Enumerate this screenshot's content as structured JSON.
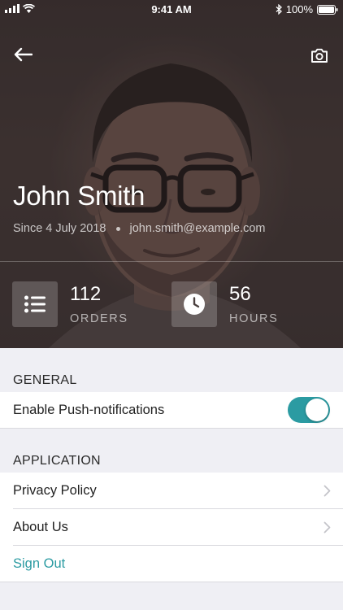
{
  "status_bar": {
    "time": "9:41 AM",
    "battery": "100%"
  },
  "profile": {
    "name": "John Smith",
    "since": "Since 4 July 2018",
    "email": "john.smith@example.com"
  },
  "stats": {
    "orders": {
      "value": "112",
      "label": "ORDERS"
    },
    "hours": {
      "value": "56",
      "label": "HOURS"
    }
  },
  "sections": {
    "general": {
      "header": "GENERAL",
      "push_label": "Enable Push-notifications",
      "push_enabled": true
    },
    "application": {
      "header": "APPLICATION",
      "privacy_label": "Privacy Policy",
      "about_label": "About Us",
      "signout_label": "Sign Out"
    }
  },
  "colors": {
    "accent": "#2b9ba2",
    "hero_overlay": "#3b3131",
    "background": "#efeff4"
  },
  "icons": [
    "back-arrow-icon",
    "camera-icon",
    "list-icon",
    "clock-icon",
    "chevron-right-icon",
    "signal-icon",
    "wifi-icon",
    "bluetooth-icon",
    "battery-icon"
  ]
}
